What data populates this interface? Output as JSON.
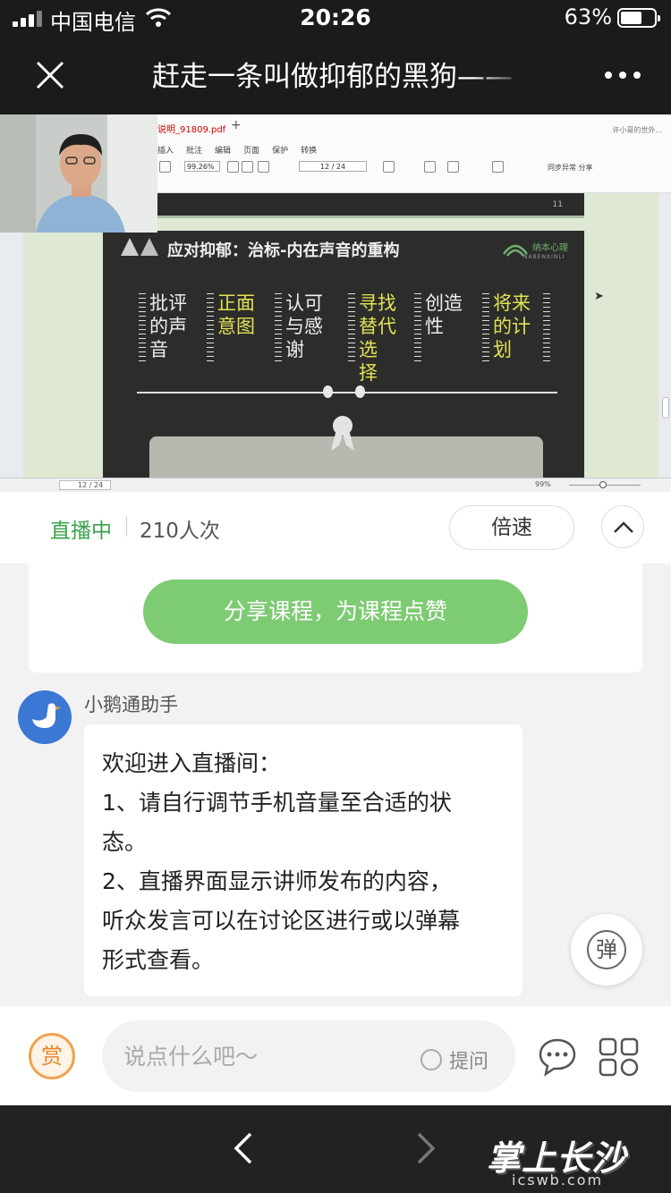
{
  "status_bar": {
    "carrier": "中国电信",
    "time": "20:26",
    "battery": "63%",
    "battery_level": 0.63
  },
  "nav": {
    "title": "赶走一条叫做抑郁的黑狗——"
  },
  "screen_share": {
    "file_tab": "说明_91809.pdf",
    "menu": [
      "插入",
      "批注",
      "编辑",
      "页面",
      "保护",
      "转换"
    ],
    "zoom": "99.26%",
    "page": "12 / 24",
    "right_tools": "同步异常  分享",
    "top_right": "许小哥的世外...",
    "slide_page_number": "11",
    "status_zoom": "99%",
    "status_page": "12 / 24"
  },
  "slide": {
    "title": "应对抑郁：治标-内在声音的重构",
    "logo": "纳本心理",
    "logo_sub": "NABENXINLI",
    "columns": [
      {
        "line1": "批评",
        "line2": "的声",
        "line3": "音",
        "color": "white"
      },
      {
        "line1": "正面",
        "line2": "意图",
        "line3": "",
        "color": "yellow"
      },
      {
        "line1": "认可",
        "line2": "与感",
        "line3": "谢",
        "color": "white"
      },
      {
        "line1": "寻找",
        "line2": "替代",
        "line3": "选",
        "line4": "择",
        "color": "yellow"
      },
      {
        "line1": "创造",
        "line2": "性",
        "line3": "",
        "color": "white"
      },
      {
        "line1": "将来",
        "line2": "的计",
        "line3": "划",
        "color": "yellow"
      }
    ]
  },
  "live": {
    "status": "直播中",
    "viewers": "210人次",
    "speed_label": "倍速"
  },
  "share_course_label": "分享课程，为课程点赞",
  "message": {
    "sender": "小鹅通助手",
    "lines": [
      "欢迎进入直播间：",
      "1、请自行调节手机音量至合适的状",
      "态。",
      "2、直播界面显示讲师发布的内容，",
      "听众发言可以在讨论区进行或以弹幕",
      "形式查看。"
    ]
  },
  "danmu_label": "弹",
  "input_bar": {
    "reward_label": "赏",
    "placeholder": "说点什么吧～",
    "ask_label": "提问"
  },
  "watermark": {
    "text": "掌上长沙",
    "sub": "icswb.com"
  },
  "colors": {
    "accent_green": "#3aa34a",
    "button_green": "#7dcb73",
    "avatar_blue": "#3b78d4",
    "reward_orange": "#e8872b",
    "slide_yellow": "#e2e256"
  }
}
